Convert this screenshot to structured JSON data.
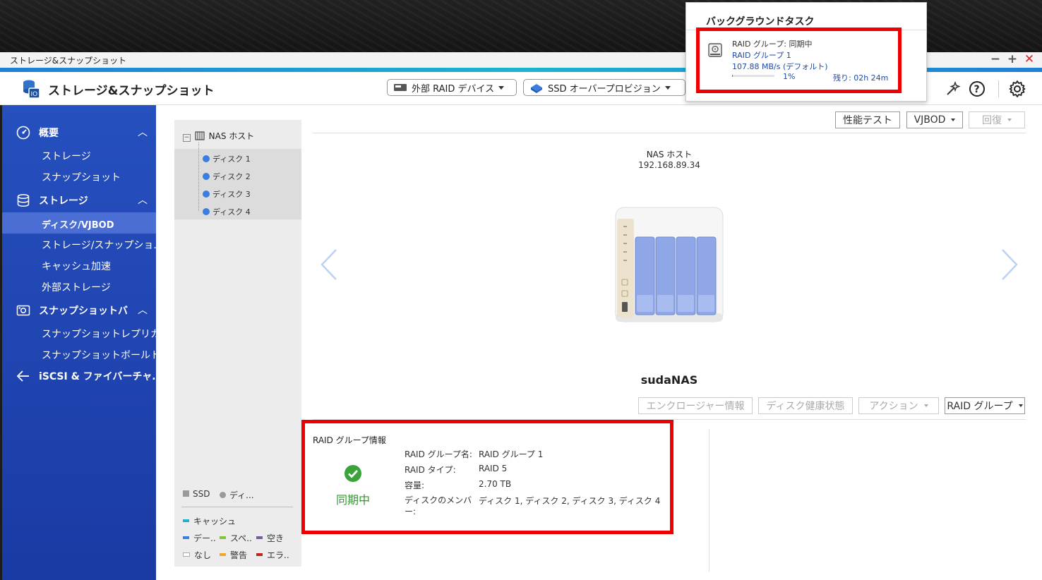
{
  "window": {
    "title": "ストレージ&スナップショット",
    "controls": [
      "−",
      "+",
      "✕"
    ]
  },
  "app_header": {
    "title": "ストレージ&スナップショット",
    "ext_raid_button": "外部 RAID デバイス",
    "ssd_button": "SSD オーバープロビジョン"
  },
  "sidebar": {
    "sections": [
      {
        "label": "概要",
        "icon": "speedometer-icon",
        "chevron": "︿",
        "items": [
          "ストレージ",
          "スナップショット"
        ]
      },
      {
        "label": "ストレージ",
        "icon": "database-icon",
        "chevron": "︿",
        "items": [
          "ディスク/VJBOD",
          "ストレージ/スナップショ..",
          "キャッシュ加速",
          "外部ストレージ"
        ]
      },
      {
        "label": "スナップショットバ",
        "icon": "snapshot-icon",
        "chevron": "︿",
        "items": [
          "スナップショットレプリカ",
          "スナップショットボールト"
        ]
      },
      {
        "label": "iSCSI & ファイバーチャ..",
        "icon": "iscsi-icon",
        "chevron": "",
        "items": []
      }
    ],
    "active_item": "ディスク/VJBOD"
  },
  "toolbar": {
    "perf_test": "性能テスト",
    "vjbod": "VJBOD",
    "restore": "回復"
  },
  "tree": {
    "host": "NAS ホスト",
    "disks": [
      "ディスク 1",
      "ディスク 2",
      "ディスク 3",
      "ディスク 4"
    ]
  },
  "legend": {
    "type_row": [
      "SSD",
      "ディ..."
    ],
    "cache": "キャッシュ",
    "row2": [
      "デー..",
      "スペ..",
      "空き"
    ],
    "row3": [
      "なし",
      "警告",
      "エラ.."
    ],
    "colors": {
      "cache": "#1bb4cf",
      "data": "#3b7de0",
      "spare": "#7dc832",
      "free": "#7a5b99",
      "none": "#ffffff",
      "warning": "#f5a623",
      "error": "#cc1f1f"
    }
  },
  "nas": {
    "name_label": "NAS ホスト",
    "ip": "192.168.89.34",
    "hostname": "sudaNAS"
  },
  "device_tabs": {
    "enclosure": "エンクロージャー情報",
    "disk_health": "ディスク健康状態",
    "action": "アクション",
    "raid_group": "RAID グループ"
  },
  "raid_info": {
    "title": "RAID グループ情報",
    "status": "同期中",
    "rows": [
      {
        "label": "RAID グループ名:",
        "value": "RAID グループ 1"
      },
      {
        "label": "RAID タイプ:",
        "value": "RAID 5"
      },
      {
        "label": "容量:",
        "value": "2.70 TB"
      },
      {
        "label": "ディスクのメンバ\nー:",
        "value": "ディスク 1, ディスク 2, ディスク 3, ディスク 4"
      }
    ]
  },
  "background_tasks": {
    "title": "バックグラウンドタスク",
    "task": {
      "status": "RAID グループ: 同期中",
      "name": "RAID グループ 1",
      "speed": "107.88 MB/s (デフォルト)",
      "percent_text": "1%",
      "progress": 0.01,
      "remaining": "残り: 02h 24m"
    }
  }
}
